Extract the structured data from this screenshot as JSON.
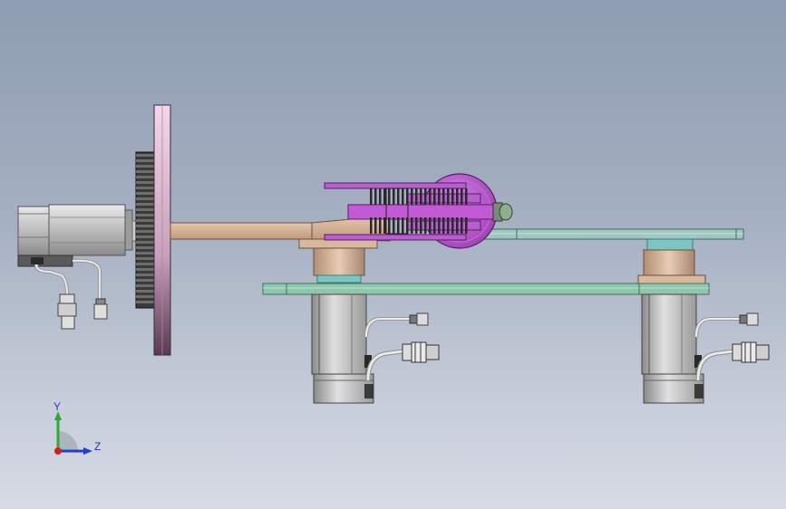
{
  "viewport": {
    "background_top": "#8e9db1",
    "background_bottom": "#d6dbe5"
  },
  "triad": {
    "y_label": "Y",
    "z_label": "Z",
    "y_color": "#2fa83a",
    "z_color": "#2040c8",
    "x_color": "#d02020"
  },
  "colors": {
    "motor_body": "#c9c9c9",
    "disk": "#e6c9dc",
    "arm": "#d8b59a",
    "gear_head": "#b44fc8",
    "plate_green": "#8fc7ad",
    "plate_teal": "#9fc8c0",
    "bearing": "#d8b59a"
  },
  "parts": [
    "left-servo-motor",
    "drive-gear",
    "rotary-disk",
    "swing-arm",
    "gripper-head",
    "base-plate",
    "upper-plate",
    "left-bearing-block",
    "right-bearing-block",
    "left-vertical-motor",
    "right-vertical-motor"
  ]
}
